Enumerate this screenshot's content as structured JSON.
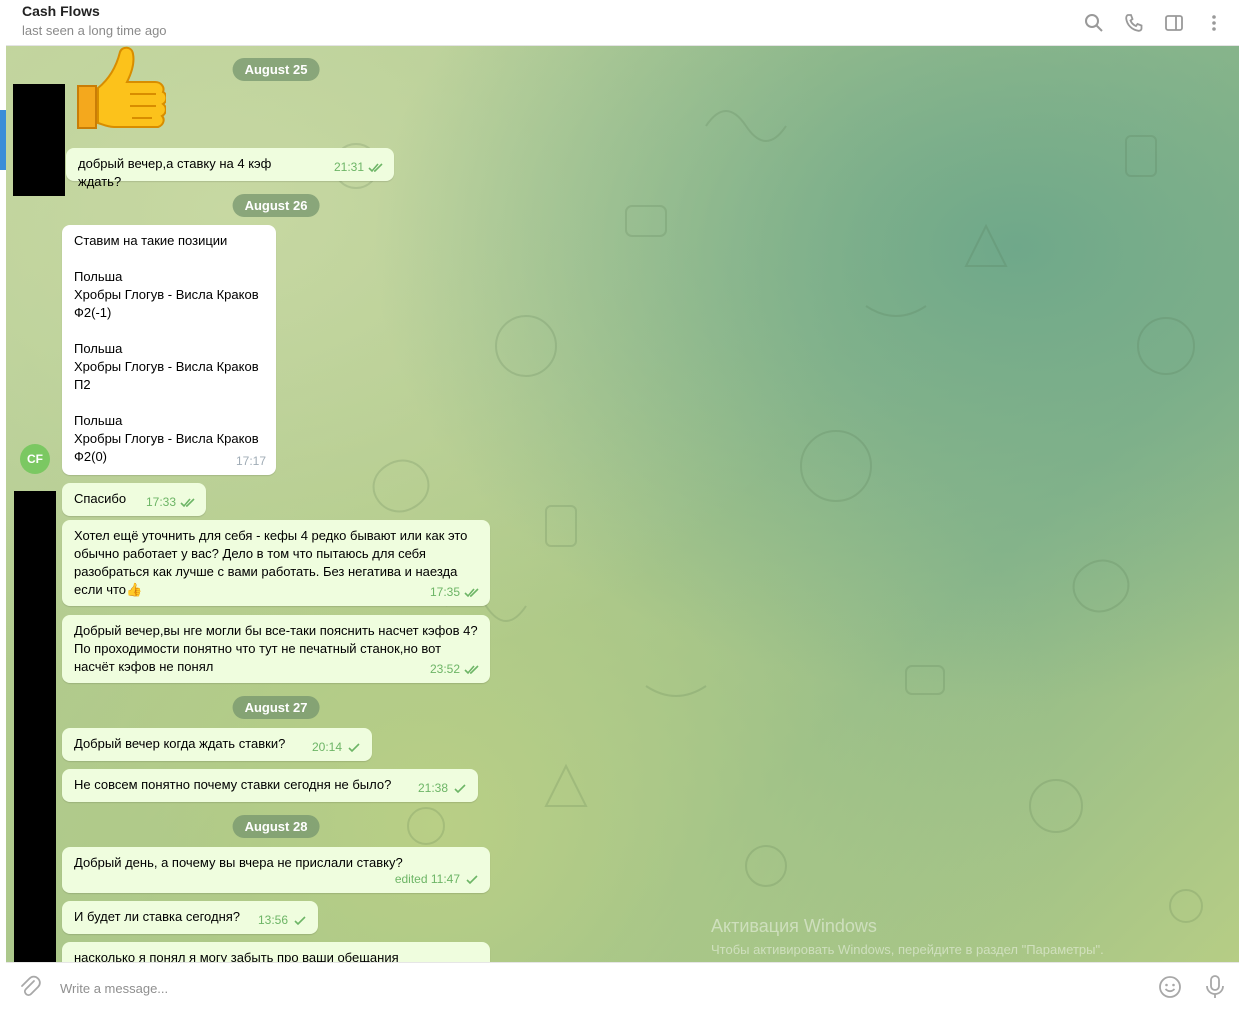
{
  "header": {
    "title": "Cash Flows",
    "status": "last seen a long time ago",
    "icons": [
      "search-icon",
      "phone-icon",
      "sidebar-toggle-icon",
      "more-vertical-icon"
    ]
  },
  "avatar": {
    "initials": "CF",
    "color": "#7bc862"
  },
  "dates": {
    "d1": "August 25",
    "d2": "August 26",
    "d3": "August 27",
    "d4": "August 28"
  },
  "messages": {
    "m1": {
      "text": "добрый вечер,а ставку на 4 кэф ждать?",
      "time": "21:31"
    },
    "m2": {
      "text": "Ставим на такие позиции\n\nПольша\nХробры Глогув - Висла Краков\nФ2(-1)\n\nПольша\nХробры Глогув - Висла Краков\nП2\n\nПольша\nХробры Глогув - Висла Краков\nФ2(0)",
      "time": "17:17"
    },
    "m3": {
      "text": "Спасибо",
      "time": "17:33"
    },
    "m4": {
      "text": "Хотел ещё уточнить для себя - кефы 4 редко бывают или как это обычно работает у вас? Дело в том что пытаюсь для себя разобраться как лучше с вами работать. Без негатива и наезда если что👍",
      "time": "17:35"
    },
    "m5": {
      "text": "Добрый вечер,вы нге могли бы все-таки пояснить насчет кэфов 4?По проходимости понятно что тут не печатный станок,но вот насчёт кэфов не понял",
      "time": "23:52"
    },
    "m6": {
      "text": "Добрый вечер когда ждать ставки?",
      "time": "20:14"
    },
    "m7": {
      "text": "Не совсем понятно почему ставки сегодня не было?",
      "time": "21:38"
    },
    "m8": {
      "text": "Добрый день, а почему вы вчера не прислали ставку?",
      "time": "edited 11:47"
    },
    "m9": {
      "text": "И будет ли ставка сегодня?",
      "time": "13:56"
    },
    "m10": {
      "text": "насколько я понял я могу забыть про ваши обещания",
      "time": ""
    }
  },
  "watermark": {
    "title": "Активация Windows",
    "subtitle": "Чтобы активировать Windows, перейдите в раздел \"Параметры\"."
  },
  "composer": {
    "placeholder": "Write a message..."
  },
  "colors": {
    "outgoing_bubble": "#effdde",
    "incoming_bubble": "#ffffff",
    "check": "#6db566",
    "accent": "#3a8dd8"
  }
}
